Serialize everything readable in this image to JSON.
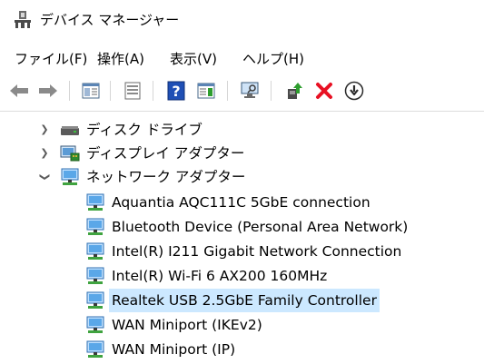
{
  "window": {
    "title": "デバイス マネージャー",
    "icon": "device-manager-icon"
  },
  "menu": [
    {
      "label": "ファイル(F)"
    },
    {
      "label": "操作(A)"
    },
    {
      "label": "表示(V)"
    },
    {
      "label": "ヘルプ(H)"
    }
  ],
  "toolbar": {
    "buttons": [
      "back-arrow-icon",
      "forward-arrow-icon",
      "show-hide-console-tree-icon",
      "properties-icon",
      "help-icon",
      "show-action-pane-icon",
      "scan-hardware-changes-icon",
      "update-driver-icon",
      "uninstall-device-icon",
      "disable-device-icon"
    ]
  },
  "tree": {
    "categories": [
      {
        "label": "ディスク ドライブ",
        "expanded": false,
        "icon": "disk-drive-icon"
      },
      {
        "label": "ディスプレイ アダプター",
        "expanded": false,
        "icon": "display-adapter-icon"
      },
      {
        "label": "ネットワーク アダプター",
        "expanded": true,
        "icon": "network-adapter-icon"
      }
    ],
    "network_adapters": [
      {
        "label": "Aquantia AQC111C 5GbE connection",
        "selected": false
      },
      {
        "label": "Bluetooth Device (Personal Area Network)",
        "selected": false
      },
      {
        "label": "Intel(R) I211 Gigabit Network Connection",
        "selected": false
      },
      {
        "label": "Intel(R) Wi-Fi 6 AX200 160MHz",
        "selected": false
      },
      {
        "label": "Realtek USB 2.5GbE Family Controller",
        "selected": true
      },
      {
        "label": "WAN Miniport (IKEv2)",
        "selected": false
      },
      {
        "label": "WAN Miniport (IP)",
        "selected": false
      }
    ]
  },
  "colors": {
    "selection": "#cce8ff",
    "accent_green": "#2e9e2e",
    "delete_red": "#e81123",
    "help_blue": "#1f4fb5"
  }
}
